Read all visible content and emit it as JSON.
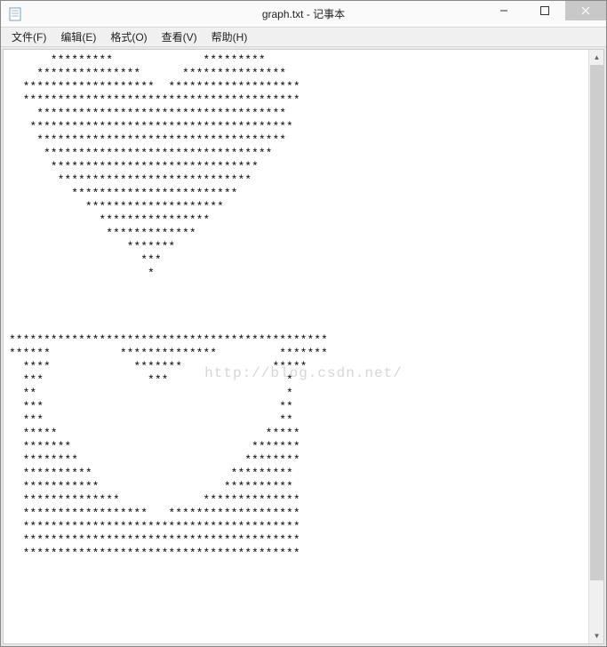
{
  "window": {
    "title": "graph.txt - 记事本"
  },
  "menubar": {
    "items": [
      {
        "label": "文件(F)"
      },
      {
        "label": "编辑(E)"
      },
      {
        "label": "格式(O)"
      },
      {
        "label": "查看(V)"
      },
      {
        "label": "帮助(H)"
      }
    ]
  },
  "content": {
    "lines": [
      "      *********             *********",
      "    ***************      ***************",
      "  *******************  *******************",
      "  ****************************************",
      "    ************************************",
      "   **************************************",
      "    ************************************",
      "     *********************************",
      "      ******************************",
      "       ****************************",
      "         ************************",
      "           ********************",
      "             ****************",
      "              *************",
      "                 *******",
      "                   ***",
      "                    *",
      "",
      "",
      "",
      "",
      "**********************************************",
      "******          **************         *******",
      "  ****            *******             *****",
      "  ***               ***                 *",
      "  **                                    *",
      "  ***                                  **",
      "  ***                                  **",
      "  *****                              *****",
      "  *******                          *******",
      "  ********                        ********",
      "  **********                    *********",
      "  ***********                  **********",
      "  **************            **************",
      "  ******************   *******************",
      "  ****************************************",
      "  ****************************************",
      "  ****************************************"
    ]
  },
  "watermark": "http://blog.csdn.net/"
}
